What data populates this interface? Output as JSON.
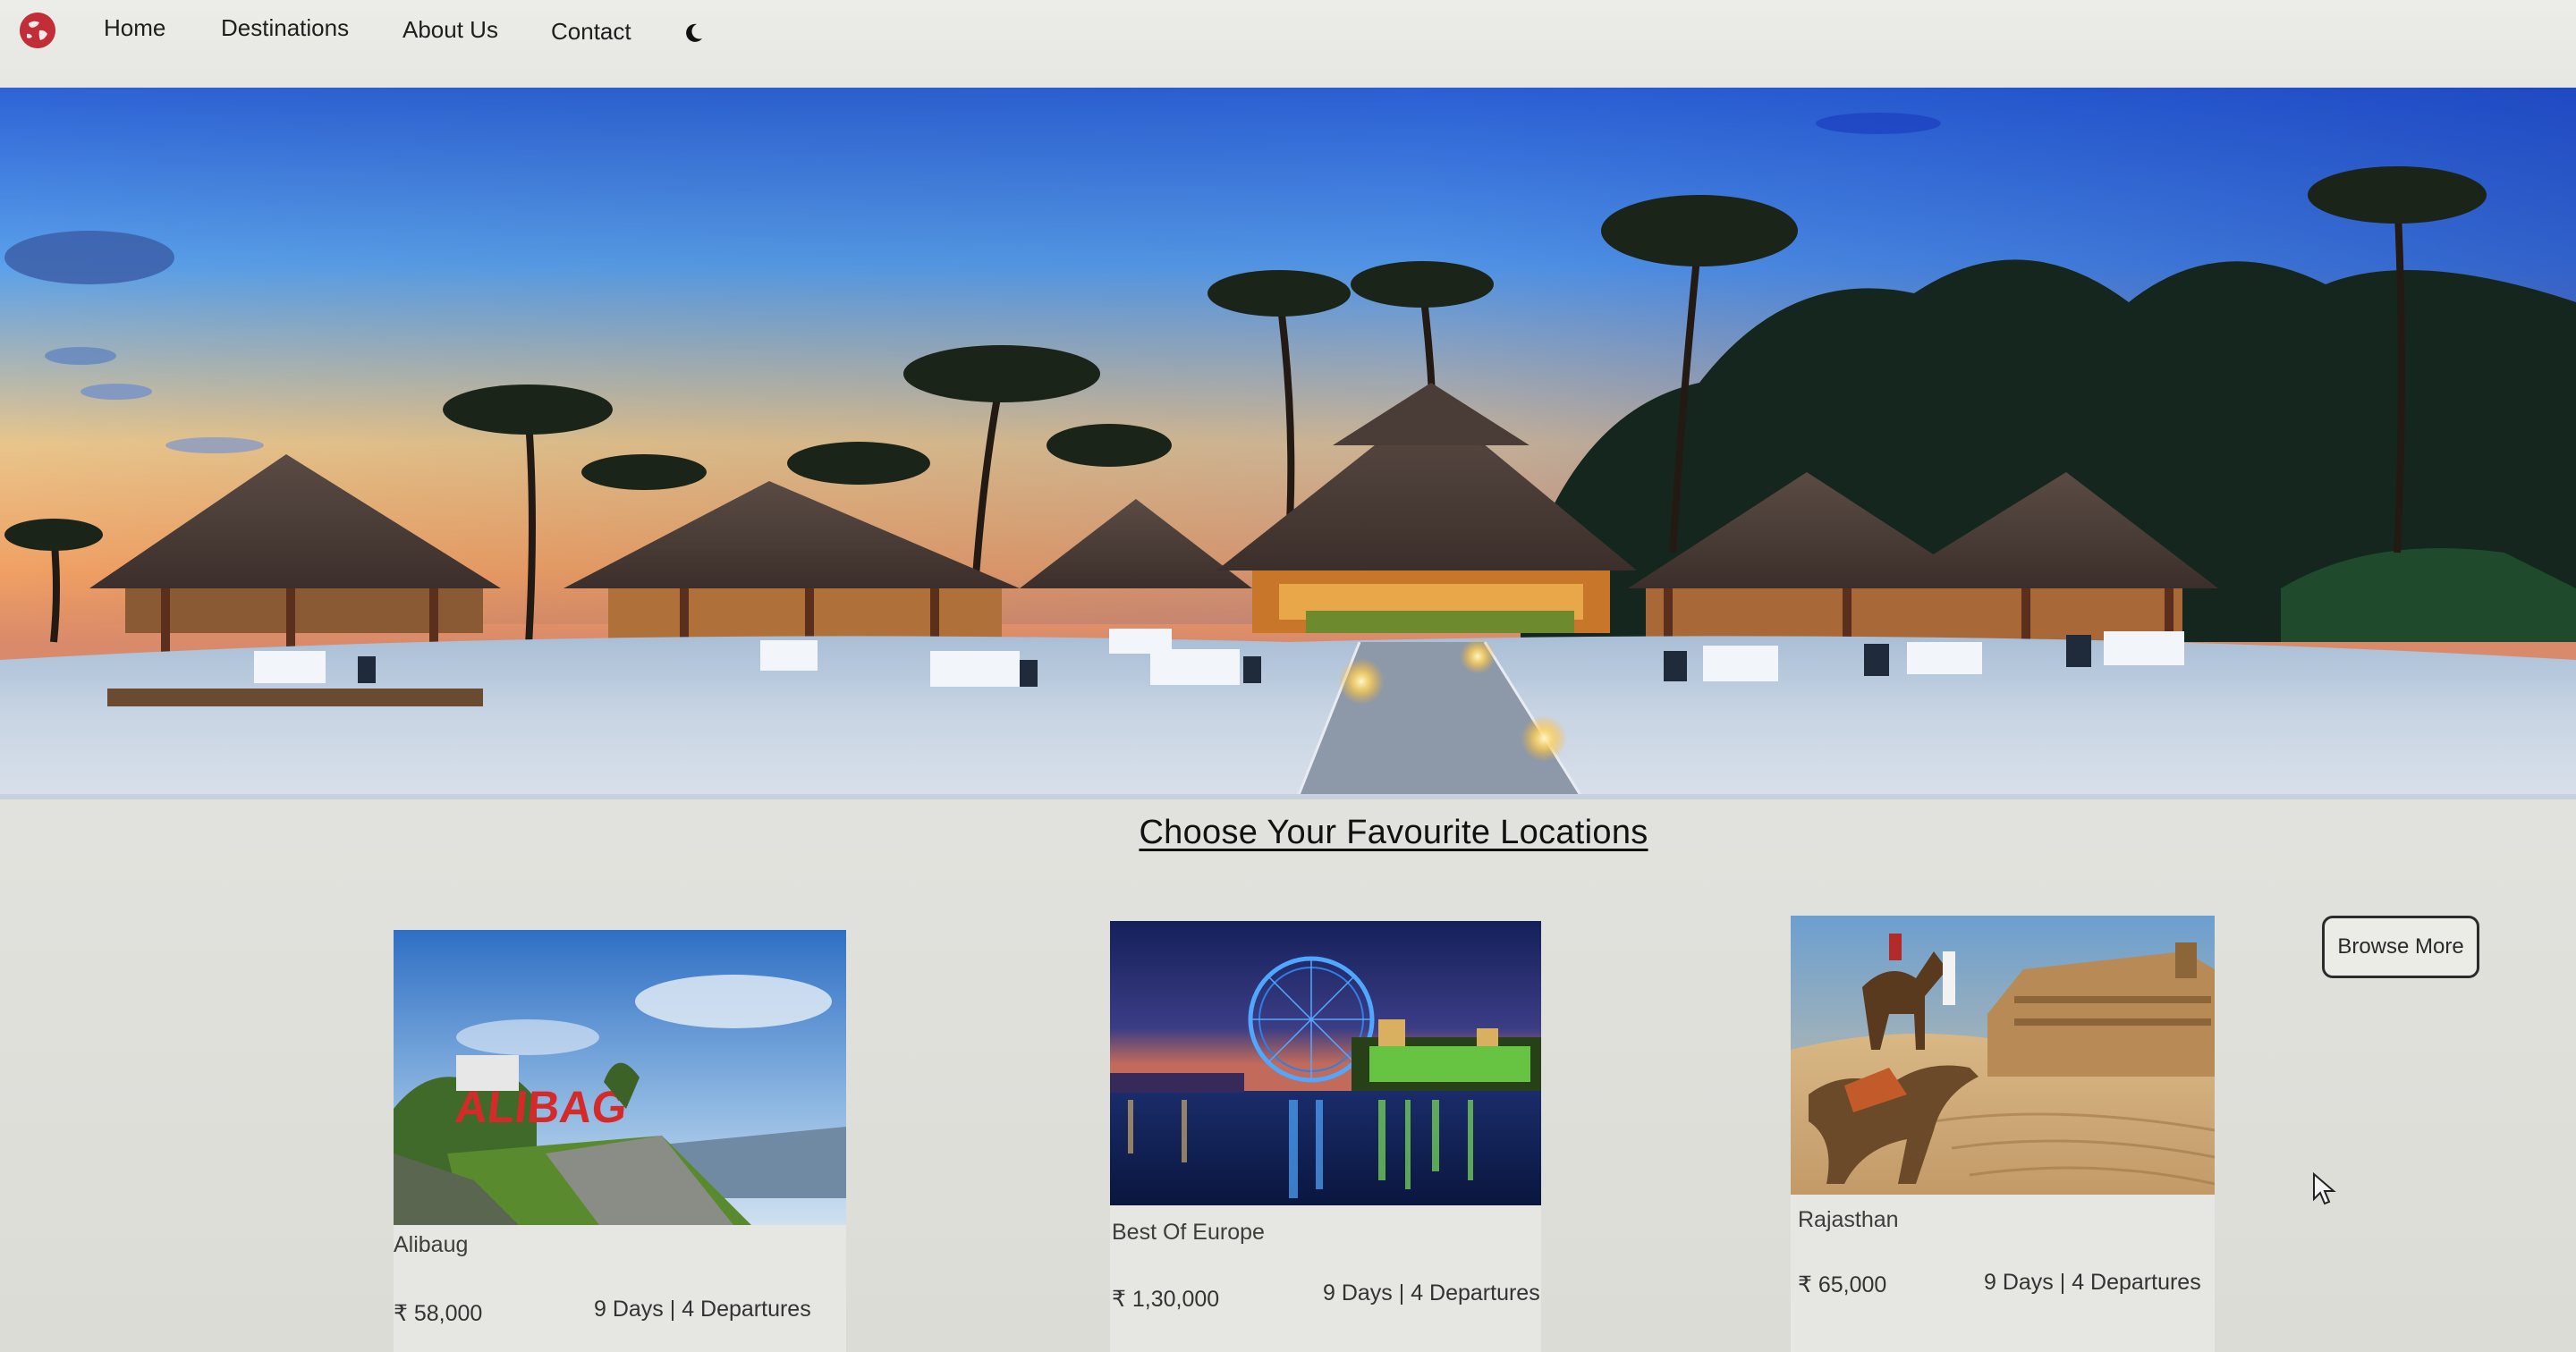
{
  "nav": {
    "logo_icon": "globe-icon",
    "links": [
      "Home",
      "Destinations",
      "About Us",
      "Contact"
    ],
    "theme_toggle_icon": "moon-icon"
  },
  "hero": {
    "image": "tropical-beach-resort-at-dusk"
  },
  "section": {
    "title": "Choose Your Favourite Locations"
  },
  "cards": [
    {
      "name": "Alibaug",
      "price": "₹ 58,000",
      "info": "9 Days | 4 Departures",
      "image": "alibaug-seaside-sign"
    },
    {
      "name": "Best Of Europe",
      "price": "₹ 1,30,000",
      "info": "9 Days | 4 Departures",
      "image": "london-eye-at-night"
    },
    {
      "name": "Rajasthan",
      "price": "₹ 65,000",
      "info": "9 Days | 4 Departures",
      "image": "desert-camels-and-fort"
    }
  ],
  "browse_button": {
    "label": "Browse More"
  },
  "colors": {
    "nav_bg": "#e8e8e4",
    "page_bg": "#e2e3de",
    "text": "#1e1e1e",
    "logo_red": "#c62f3a"
  }
}
